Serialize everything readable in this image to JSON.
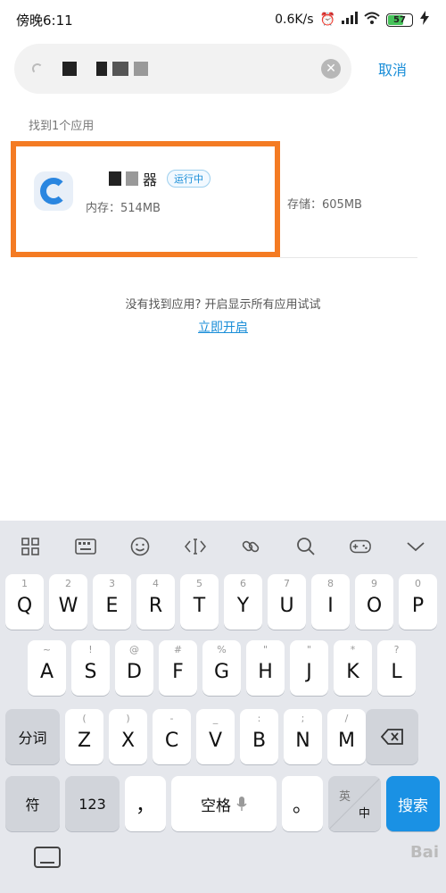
{
  "status_bar": {
    "time": "傍晚6:11",
    "speed": "0.6K/s",
    "battery": "57"
  },
  "search": {
    "cancel_label": "取消",
    "clear_icon": "clear-icon"
  },
  "results": {
    "found_label": "找到1个应用",
    "app": {
      "name_suffix": "器",
      "status_badge": "运行中",
      "memory": "内存：514MB",
      "storage": "存储：605MB"
    }
  },
  "footer": {
    "hint": "没有找到应用? 开启显示所有应用试试",
    "enable_link": "立即开启"
  },
  "keyboard": {
    "row1": [
      {
        "hint": "1",
        "key": "Q"
      },
      {
        "hint": "2",
        "key": "W"
      },
      {
        "hint": "3",
        "key": "E"
      },
      {
        "hint": "4",
        "key": "R"
      },
      {
        "hint": "5",
        "key": "T"
      },
      {
        "hint": "6",
        "key": "Y"
      },
      {
        "hint": "7",
        "key": "U"
      },
      {
        "hint": "8",
        "key": "I"
      },
      {
        "hint": "9",
        "key": "O"
      },
      {
        "hint": "0",
        "key": "P"
      }
    ],
    "row2": [
      {
        "hint": "~",
        "key": "A"
      },
      {
        "hint": "!",
        "key": "S"
      },
      {
        "hint": "@",
        "key": "D"
      },
      {
        "hint": "#",
        "key": "F"
      },
      {
        "hint": "%",
        "key": "G"
      },
      {
        "hint": "\"",
        "key": "H"
      },
      {
        "hint": "\"",
        "key": "J"
      },
      {
        "hint": "*",
        "key": "K"
      },
      {
        "hint": "?",
        "key": "L"
      }
    ],
    "row3": [
      {
        "hint": "(",
        "key": "Z"
      },
      {
        "hint": ")",
        "key": "X"
      },
      {
        "hint": "-",
        "key": "C"
      },
      {
        "hint": "_",
        "key": "V"
      },
      {
        "hint": ":",
        "key": "B"
      },
      {
        "hint": ";",
        "key": "N"
      },
      {
        "hint": "/",
        "key": "M"
      }
    ],
    "fenci_label": "分词",
    "fu_label": "符",
    "num_label": "123",
    "comma_label": "，",
    "space_label": "空格",
    "period_label": "。",
    "lang_top": "英",
    "lang_bottom": "中",
    "search_label": "搜索",
    "watermark": "Bai"
  }
}
